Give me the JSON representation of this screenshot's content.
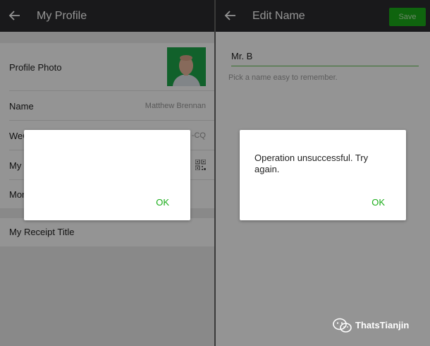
{
  "left_screen": {
    "header": {
      "title": "My Profile",
      "back_icon": "back-arrow-icon"
    },
    "rows": [
      {
        "label": "Profile Photo",
        "value": ""
      },
      {
        "label": "Name",
        "value": "Matthew Brennan"
      },
      {
        "label": "WeC",
        "value": "-CQ"
      },
      {
        "label": "My",
        "value": ""
      },
      {
        "label": "Mor",
        "value": ""
      }
    ],
    "receipt_row": {
      "label": "My Receipt Title"
    },
    "dialog": {
      "message": "",
      "ok_label": "OK"
    }
  },
  "right_screen": {
    "header": {
      "title": "Edit Name",
      "save_label": "Save",
      "back_icon": "back-arrow-icon"
    },
    "name_input": {
      "value": "Mr. B"
    },
    "hint": "Pick a name easy to remember.",
    "dialog": {
      "message": "Operation unsuccessful. Try again.",
      "ok_label": "OK"
    }
  },
  "watermark": {
    "text": "ThatsTianjin",
    "icon": "wechat-icon"
  },
  "colors": {
    "accent_green": "#1aad19",
    "topbar": "#2b2b2f",
    "avatar_bg": "#1ea84a"
  }
}
